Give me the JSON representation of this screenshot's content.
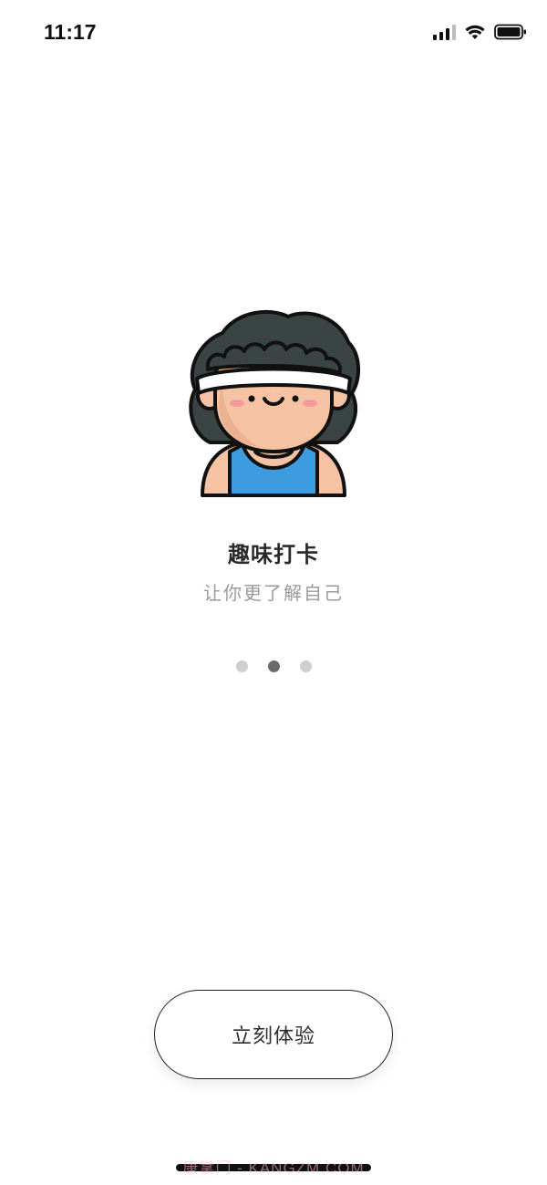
{
  "status_bar": {
    "time": "11:17",
    "icons": [
      "cellular-signal-icon",
      "wifi-icon",
      "battery-icon"
    ]
  },
  "onboarding": {
    "illustration": "athlete-avatar-illustration",
    "title": "趣味打卡",
    "subtitle": "让你更了解自己",
    "pager": {
      "total": 3,
      "active_index": 1
    }
  },
  "cta": {
    "label": "立刻体验"
  },
  "watermark": {
    "text": "康掌门 - KANGZM.COM"
  },
  "colors": {
    "hair": "#3b4445",
    "headband": "#ffffff",
    "skin": "#f5c3a3",
    "skin_shadow": "#e8a98a",
    "jersey": "#3d9be0",
    "cheek": "#f29b9b",
    "outline": "#111111",
    "dot_active": "#6b6b6b",
    "dot_inactive": "#cfcfcf"
  }
}
